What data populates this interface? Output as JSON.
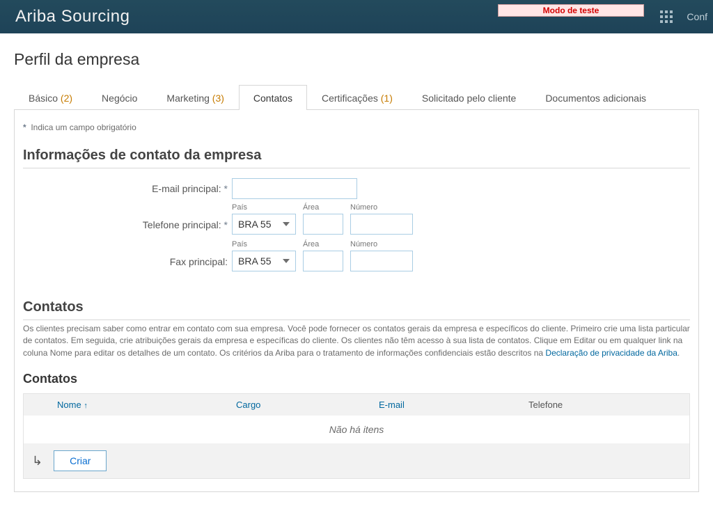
{
  "header": {
    "brand": "Ariba Sourcing",
    "test_mode": "Modo de teste",
    "config_label": "Conf"
  },
  "page": {
    "title": "Perfil da empresa",
    "required_note": "Indica um campo obrigatório"
  },
  "tabs": [
    {
      "label": "Básico",
      "count": "(2)",
      "active": false
    },
    {
      "label": "Negócio",
      "count": "",
      "active": false
    },
    {
      "label": "Marketing",
      "count": "(3)",
      "active": false
    },
    {
      "label": "Contatos",
      "count": "",
      "active": true
    },
    {
      "label": "Certificações",
      "count": "(1)",
      "active": false
    },
    {
      "label": "Solicitado pelo cliente",
      "count": "",
      "active": false
    },
    {
      "label": "Documentos adicionais",
      "count": "",
      "active": false
    }
  ],
  "section_contact_info": {
    "title": "Informações de contato da empresa",
    "email_label": "E-mail principal:",
    "phone_label": "Telefone principal:",
    "fax_label": "Fax principal:",
    "sub_country": "País",
    "sub_area": "Área",
    "sub_number": "Número",
    "country_value": "BRA 55",
    "email_value": "",
    "phone_area_value": "",
    "phone_number_value": "",
    "fax_area_value": "",
    "fax_number_value": ""
  },
  "section_contacts": {
    "title": "Contatos",
    "desc_part1": "Os clientes precisam saber como entrar em contato com sua empresa. Você pode fornecer os contatos gerais da empresa e específicos do cliente. Primeiro crie uma lista particular de contatos. Em seguida, crie atribuições gerais da empresa e específicas do cliente. Os clientes não têm acesso à sua lista de contatos. Clique em Editar ou em qualquer link na coluna Nome para editar os detalhes de um contato. Os critérios da Ariba para o tratamento de informações confidenciais estão descritos na ",
    "privacy_link": "Declaração de privacidade da Ariba",
    "subtitle": "Contatos",
    "col_name": "Nome",
    "col_cargo": "Cargo",
    "col_email": "E-mail",
    "col_tel": "Telefone",
    "no_items": "Não há itens",
    "create_btn": "Criar"
  }
}
